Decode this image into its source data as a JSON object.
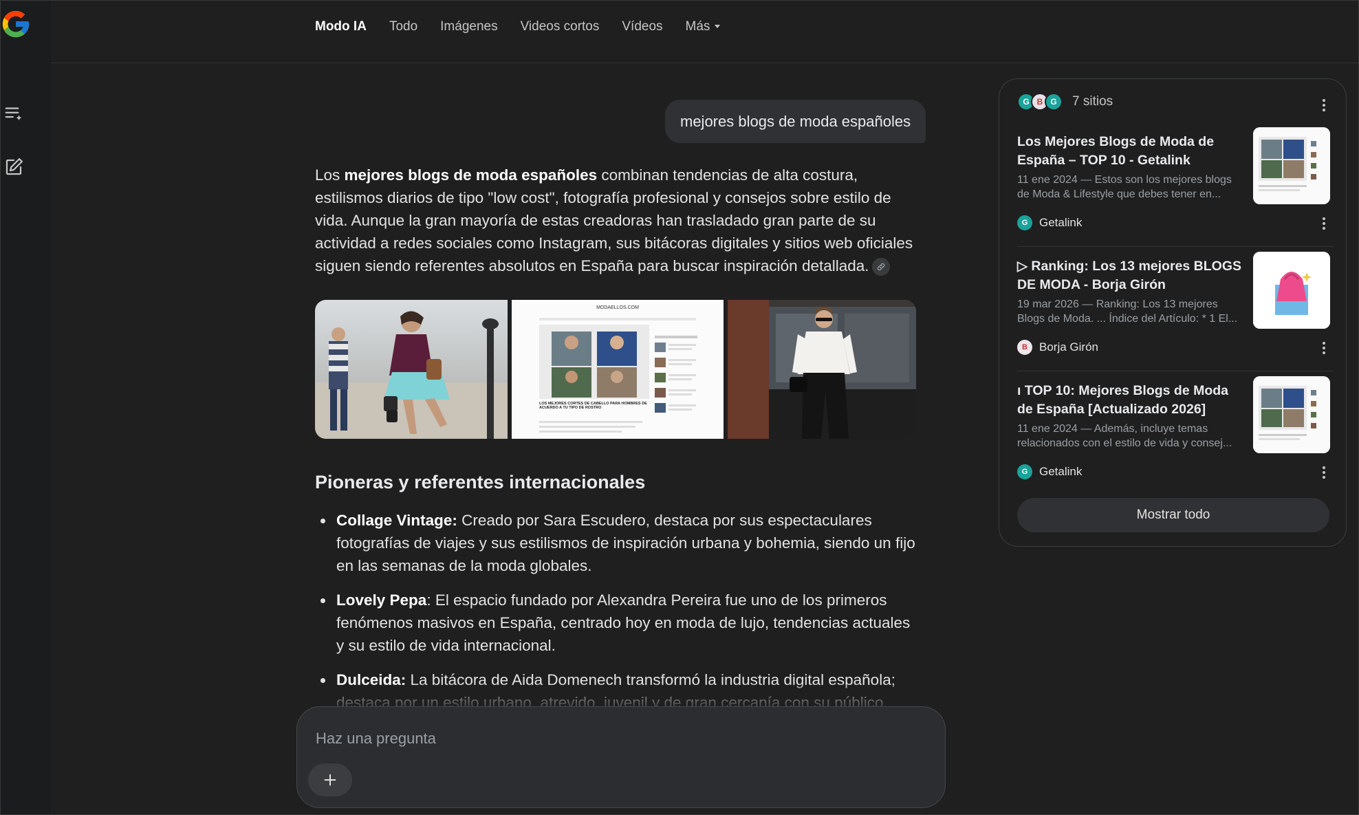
{
  "nav": {
    "tabs": [
      "Modo IA",
      "Todo",
      "Imágenes",
      "Videos cortos",
      "Vídeos",
      "Más"
    ]
  },
  "query": "mejores blogs de moda españoles",
  "answer": {
    "intro_pre": "Los ",
    "intro_bold": "mejores blogs de moda españoles",
    "intro_post": " combinan tendencias de alta costura, estilismos diarios de tipo \"low cost\", fotografía profesional y consejos sobre estilo de vida. Aunque la gran mayoría de estas creadoras han trasladado gran parte de su actividad a redes sociales como Instagram, sus bitácoras digitales y sitios web oficiales siguen siendo referentes absolutos en España para buscar inspiración detallada.",
    "section_title": "Pioneras y referentes internacionales",
    "items": [
      {
        "name": "Collage Vintage:",
        "text": " Creado por Sara Escudero, destaca por sus espectaculares fotografías de viajes y sus estilismos de inspiración urbana y bohemia, siendo un fijo en las semanas de la moda globales."
      },
      {
        "name": "Lovely Pepa",
        "text": ": El espacio fundado por Alexandra Pereira fue uno de los primeros fenómenos masivos en España, centrado hoy en moda de lujo, tendencias actuales y su estilo de vida internacional."
      },
      {
        "name": "Dulceida:",
        "text": " La bitácora de Aida Domenech transformó la industria digital española; destaca por un estilo urbano, atrevido, juvenil y de gran cercanía con su público."
      }
    ]
  },
  "ask": {
    "placeholder": "Haz una pregunta"
  },
  "sources": {
    "count_label": "7 sitios",
    "items": [
      {
        "title": "Los Mejores Blogs de Moda de España – TOP 10 - Getalink",
        "snippet": "11 ene 2024 — Estos son los mejores blogs de Moda & Lifestyle que debes tener en...",
        "site": "Getalink"
      },
      {
        "title": "▷ Ranking: Los 13 mejores BLOGS DE MODA - Borja Girón",
        "snippet": "19 mar 2026 — Ranking: Los 13 mejores Blogs de Moda. ... Índice del Artículo: * 1 El...",
        "site": "Borja Girón"
      },
      {
        "title": "ı TOP 10: Mejores Blogs de Moda de España [Actualizado 2026]",
        "snippet": "11 ene 2024 — Además, incluye temas relacionados con el estilo de vida y consej...",
        "site": "Getalink"
      }
    ],
    "show_all": "Mostrar todo"
  },
  "images": {
    "site_logo_text": "MODAELLOS.COM",
    "article_heading": "LOS MEJORES CORTES DE CABELLO PARA HOMBRES DE ACUERDO A TU TIPO DE ROSTRO"
  },
  "colors": {
    "background": "#1f1f1f",
    "accent_getalink": "#1aa39a"
  }
}
